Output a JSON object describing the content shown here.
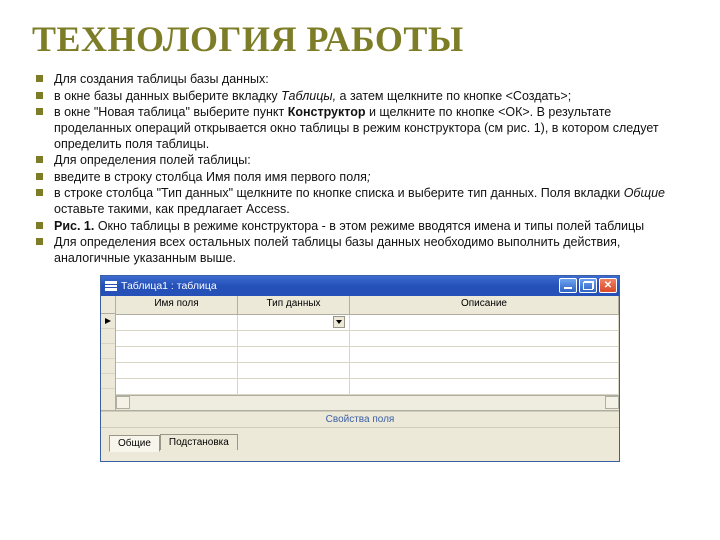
{
  "title": "ТЕХНОЛОГИЯ РАБОТЫ",
  "bullets": [
    {
      "pre": "Для создания таблицы базы данных:"
    },
    {
      "pre": "в окне базы данных выберите вкладку ",
      "em": "Таблицы,",
      "post": "  а затем щелкните по кнопке <Создать>;"
    },
    {
      "pre": "в окне \"Новая таблица\" выберите пункт ",
      "bold": "Конструктор",
      "post": " и щелкните по кнопке <ОК>. В результате проделанных операций открывается окно таблицы в режим конструктора (см рис. 1), в котором следует определить поля таблицы."
    },
    {
      "pre": "Для определения полей таблицы:"
    },
    {
      "pre": "введите в строку столбца Имя поля имя первого поля",
      "em": ";"
    },
    {
      "pre": "в строке столбца \"Тип данных\" щелкните по кнопке списка и выберите тип данных. Поля вкладки ",
      "em": "Общие",
      "post": " оставьте такими, как предлагает Access."
    },
    {
      "bold": "Рис. 1.",
      "post": " Окно таблицы в режиме конструктора - в этом режиме вводятся имена и типы полей таблицы"
    },
    {
      "pre": "Для определения всех остальных полей таблицы базы данных необходимо выполнить действия, аналогичные указанным выше."
    }
  ],
  "window": {
    "title": "Таблица1 : таблица",
    "columns": {
      "name": "Имя поля",
      "type": "Тип данных",
      "desc": "Описание"
    },
    "pane_label": "Свойства поля",
    "tabs": {
      "general": "Общие",
      "lookup": "Подстановка"
    }
  }
}
